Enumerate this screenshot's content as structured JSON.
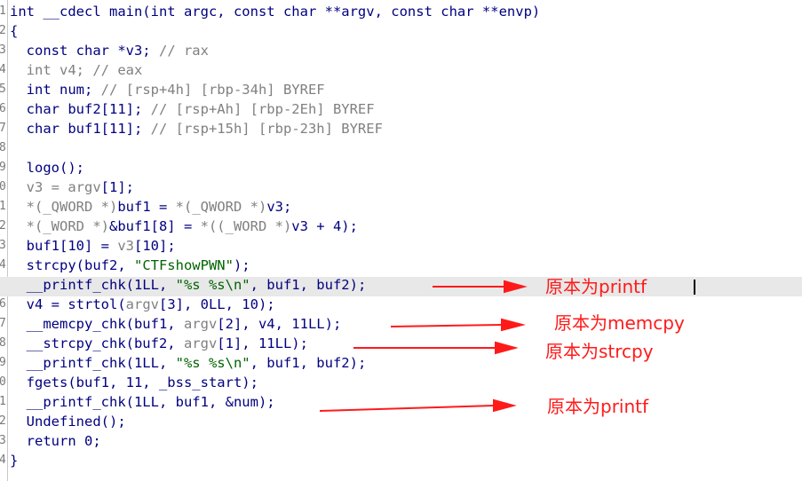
{
  "gutter": [
    "1",
    "2",
    "3",
    "4",
    "5",
    "6",
    "7",
    "8",
    "9",
    "0",
    "1",
    "2",
    "3",
    "4",
    "5",
    "6",
    "7",
    "8",
    "9",
    "0",
    "1",
    "2",
    "3",
    "4"
  ],
  "code_lines": [
    [
      {
        "t": "int __cdecl main(int argc, const char **argv, const char **envp)",
        "c": "n"
      }
    ],
    [
      {
        "t": "{",
        "c": "n"
      }
    ],
    [
      {
        "t": "  const char *v3; ",
        "c": "n"
      },
      {
        "t": "// rax",
        "c": "c"
      }
    ],
    [
      {
        "t": "  int v4; ",
        "c": "g"
      },
      {
        "t": "// eax",
        "c": "c"
      }
    ],
    [
      {
        "t": "  int num; ",
        "c": "n"
      },
      {
        "t": "// [rsp+4h] [rbp-34h] BYREF",
        "c": "c"
      }
    ],
    [
      {
        "t": "  char buf2[11]; ",
        "c": "n"
      },
      {
        "t": "// [rsp+Ah] [rbp-2Eh] BYREF",
        "c": "c"
      }
    ],
    [
      {
        "t": "  char buf1[11]; ",
        "c": "n"
      },
      {
        "t": "// [rsp+15h] [rbp-23h] BYREF",
        "c": "c"
      }
    ],
    [
      {
        "t": "",
        "c": "n"
      }
    ],
    [
      {
        "t": "  logo();",
        "c": "n"
      }
    ],
    [
      {
        "t": "  v3 = ",
        "c": "g"
      },
      {
        "t": "argv",
        "c": "g"
      },
      {
        "t": "[1];",
        "c": "n"
      }
    ],
    [
      {
        "t": "  *(_QWORD *)",
        "c": "g"
      },
      {
        "t": "buf1 = ",
        "c": "n"
      },
      {
        "t": "*(_QWORD *)",
        "c": "g"
      },
      {
        "t": "v3;",
        "c": "n"
      }
    ],
    [
      {
        "t": "  *(_WORD *)",
        "c": "g"
      },
      {
        "t": "&buf1[8] = ",
        "c": "n"
      },
      {
        "t": "*((_WORD *)",
        "c": "g"
      },
      {
        "t": "v3 + 4);",
        "c": "n"
      }
    ],
    [
      {
        "t": "  buf1[10] = ",
        "c": "n"
      },
      {
        "t": "v3",
        "c": "g"
      },
      {
        "t": "[10];",
        "c": "n"
      }
    ],
    [
      {
        "t": "  strcpy(buf2, ",
        "c": "n"
      },
      {
        "t": "\"CTFshowPWN\"",
        "c": "s"
      },
      {
        "t": ");",
        "c": "n"
      }
    ],
    [
      {
        "t": "  __printf_chk(1LL, ",
        "c": "n"
      },
      {
        "t": "\"%s %s\\n\"",
        "c": "s"
      },
      {
        "t": ", buf1, buf2);",
        "c": "n"
      }
    ],
    [
      {
        "t": "  v4 = strtol(",
        "c": "n"
      },
      {
        "t": "argv",
        "c": "g"
      },
      {
        "t": "[3], 0LL, 10);",
        "c": "n"
      }
    ],
    [
      {
        "t": "  __memcpy_chk(buf1, ",
        "c": "n"
      },
      {
        "t": "argv",
        "c": "g"
      },
      {
        "t": "[2], v4, 11LL);",
        "c": "n"
      }
    ],
    [
      {
        "t": "  __strcpy_chk(buf2, ",
        "c": "n"
      },
      {
        "t": "argv",
        "c": "g"
      },
      {
        "t": "[1], 11LL);",
        "c": "n"
      }
    ],
    [
      {
        "t": "  __printf_chk(1LL, ",
        "c": "n"
      },
      {
        "t": "\"%s %s\\n\"",
        "c": "s"
      },
      {
        "t": ", buf1, buf2);",
        "c": "n"
      }
    ],
    [
      {
        "t": "  fgets(buf1, 11, _bss_start);",
        "c": "n"
      }
    ],
    [
      {
        "t": "  __printf_chk(1LL, buf1, &num);",
        "c": "n"
      }
    ],
    [
      {
        "t": "  Undefined();",
        "c": "n"
      }
    ],
    [
      {
        "t": "  return 0;",
        "c": "n"
      }
    ],
    [
      {
        "t": "}",
        "c": "n"
      }
    ]
  ],
  "annotations": {
    "a1": "原本为printf",
    "a2": "原本为memcpy",
    "a3": "原本为strcpy",
    "a4": "原本为printf"
  },
  "colors": {
    "annotation_red": "#ff1a1a",
    "highlight_gray": "#e8e8e8"
  }
}
